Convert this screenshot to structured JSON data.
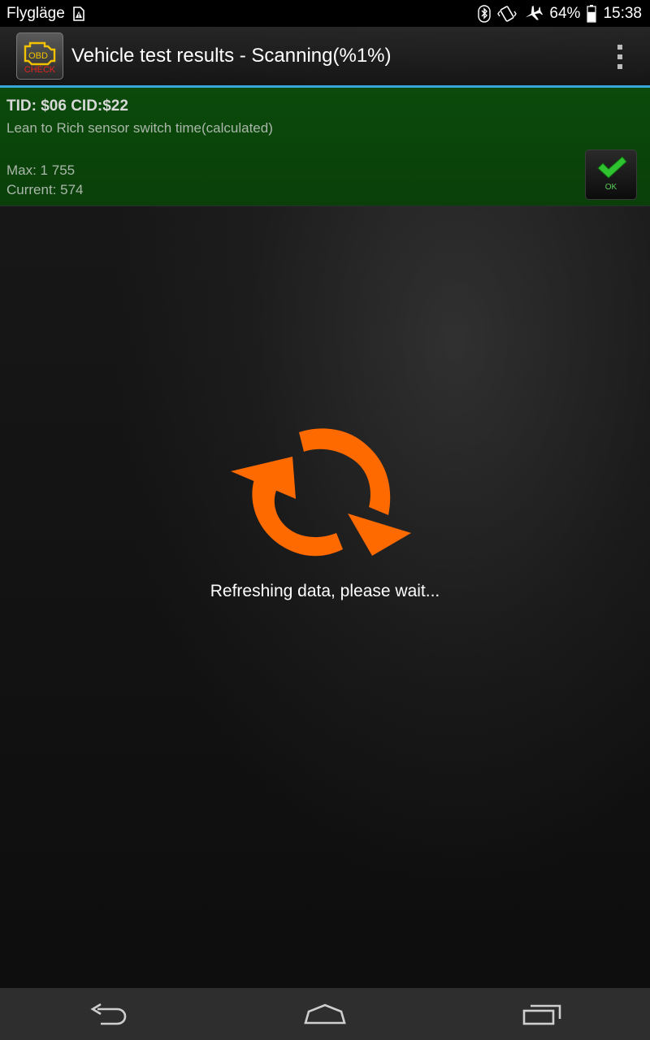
{
  "status_bar": {
    "mode_label": "Flygläge",
    "battery_percent": "64%",
    "time": "15:38",
    "icons": [
      "sim-alert-icon",
      "bluetooth-icon",
      "vibrate-icon",
      "airplane-icon",
      "battery-icon"
    ]
  },
  "action_bar": {
    "app_icon_text_top": "OBD",
    "app_icon_text_bottom": "CHECK",
    "title": "Vehicle test results - Scanning(%1%)",
    "overflow_icon": "overflow-menu-icon"
  },
  "result": {
    "tid_cid": "TID: $06 CID:$22",
    "description": "Lean to Rich sensor switch time(calculated)",
    "max": "Max: 1 755",
    "current": "Current: 574",
    "status_label": "OK",
    "status_icon": "checkmark-icon",
    "status_color": "#0a3f0a"
  },
  "loading": {
    "icon": "refresh-icon",
    "message": "Refreshing data, please wait...",
    "color": "#ff6a00"
  },
  "nav_bar": {
    "buttons": [
      "back-icon",
      "home-icon",
      "recents-icon"
    ]
  },
  "colors": {
    "accent": "#35a7dd",
    "card_green": "#0b4a0b",
    "refresh_orange": "#ff6a00"
  }
}
